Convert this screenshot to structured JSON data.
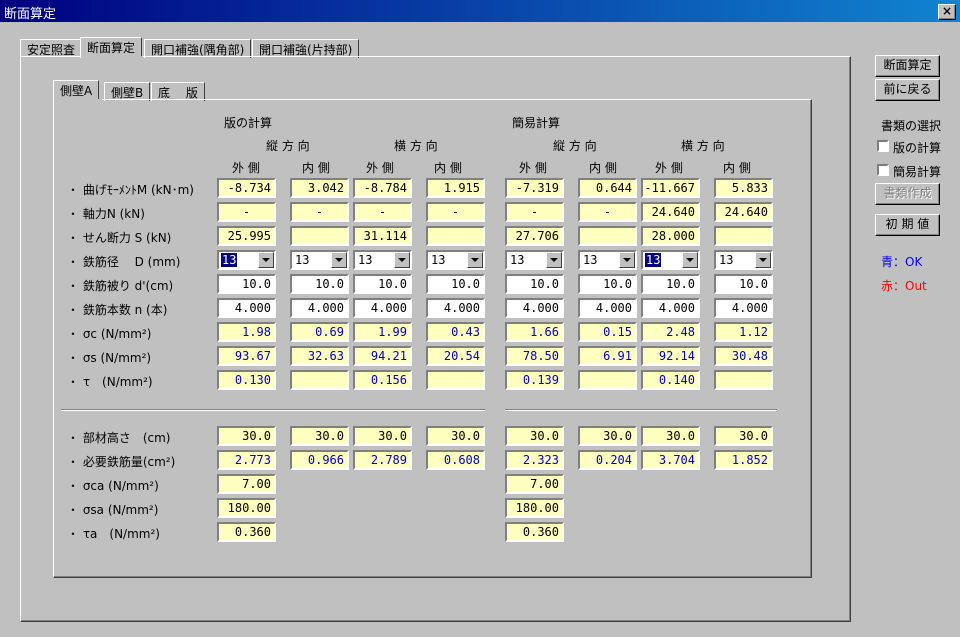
{
  "window": {
    "title": "断面算定",
    "close_label": "×"
  },
  "tabs": [
    "安定照査",
    "断面算定",
    "開口補強(隅角部)",
    "開口補強(片持部)"
  ],
  "sub_tabs": [
    "側壁A",
    "側壁B",
    "底　 版"
  ],
  "sections": {
    "slab": "版の計算",
    "simple": "簡易計算"
  },
  "directions": {
    "vertical": "縦 方 向",
    "horizontal": "横 方 向"
  },
  "sides": {
    "outer": "外 側",
    "inner": "内 側"
  },
  "row_labels": [
    "・ 曲げﾓｰﾒﾝﾄM (kN･m)",
    "・ 軸力N (kN)",
    "・ せん断力 S (kN)",
    "・ 鉄筋径　 D (mm)",
    "・ 鉄筋被り d'(cm)",
    "・ 鉄筋本数 n (本)",
    "・ σc (N/mm²)",
    "・ σs (N/mm²)",
    "・ τ　(N/mm²)"
  ],
  "row_labels2": [
    "・ 部材高さ　(cm)",
    "・ 必要鉄筋量(cm²)",
    "・ σca (N/mm²)",
    "・ σsa (N/mm²)",
    "・ τa　(N/mm²)"
  ],
  "table": [
    [
      "-8.734",
      "3.042",
      "-8.784",
      "1.915",
      "-7.319",
      "0.644",
      "-11.667",
      "5.833"
    ],
    [
      "-",
      "-",
      "-",
      "-",
      "-",
      "-",
      "24.640",
      "24.640"
    ],
    [
      "25.995",
      "",
      "31.114",
      "",
      "27.706",
      "",
      "28.000",
      ""
    ],
    [
      "13",
      "13",
      "13",
      "13",
      "13",
      "13",
      "13",
      "13"
    ],
    [
      "10.0",
      "10.0",
      "10.0",
      "10.0",
      "10.0",
      "10.0",
      "10.0",
      "10.0"
    ],
    [
      "4.000",
      "4.000",
      "4.000",
      "4.000",
      "4.000",
      "4.000",
      "4.000",
      "4.000"
    ],
    [
      "1.98",
      "0.69",
      "1.99",
      "0.43",
      "1.66",
      "0.15",
      "2.48",
      "1.12"
    ],
    [
      "93.67",
      "32.63",
      "94.21",
      "20.54",
      "78.50",
      "6.91",
      "92.14",
      "30.48"
    ],
    [
      "0.130",
      "",
      "0.156",
      "",
      "0.139",
      "",
      "0.140",
      ""
    ]
  ],
  "table2": [
    [
      "30.0",
      "30.0",
      "30.0",
      "30.0",
      "30.0",
      "30.0",
      "30.0",
      "30.0"
    ],
    [
      "2.773",
      "0.966",
      "2.789",
      "0.608",
      "2.323",
      "0.204",
      "3.704",
      "1.852"
    ],
    [
      "7.00",
      "7.00"
    ],
    [
      "180.00",
      "180.00"
    ],
    [
      "0.360",
      "0.360"
    ]
  ],
  "buttons": {
    "calc": "断面算定",
    "back": "前に戻る",
    "make_doc": "書類作成",
    "init": "初 期 値"
  },
  "doc_select": {
    "title": "書類の選択",
    "slab": "版の計算",
    "simple": "簡易計算"
  },
  "legend": {
    "ok": "青：OK",
    "out": "赤：Out",
    "ok_color": "#0000ff",
    "out_color": "#ff0000"
  }
}
